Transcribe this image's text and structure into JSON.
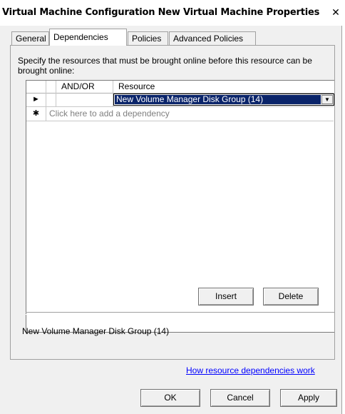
{
  "window": {
    "title": "Virtual Machine Configuration New Virtual Machine Properties",
    "close_symbol": "✕"
  },
  "tabs": [
    {
      "label": "General",
      "active": false
    },
    {
      "label": "Dependencies",
      "active": true
    },
    {
      "label": "Policies",
      "active": false
    },
    {
      "label": "Advanced Policies",
      "active": false
    }
  ],
  "dependencies": {
    "instructions": "Specify the resources that must be brought online before this resource can be brought online:",
    "grid": {
      "columns": [
        "AND/OR",
        "Resource"
      ],
      "rows": [
        {
          "indicator": "►",
          "andor": "",
          "resource": "New Volume Manager Disk Group (14)"
        }
      ],
      "new_row_indicator": "✱",
      "new_row_placeholder": "Click here to add a dependency"
    },
    "insert_button": "Insert",
    "delete_button": "Delete",
    "selected_resource": "New Volume Manager Disk Group (14)",
    "help_link": "How resource dependencies work"
  },
  "footer": {
    "ok": "OK",
    "cancel": "Cancel",
    "apply": "Apply"
  },
  "colors": {
    "selection": "#0a246a",
    "link": "#0000ff"
  }
}
